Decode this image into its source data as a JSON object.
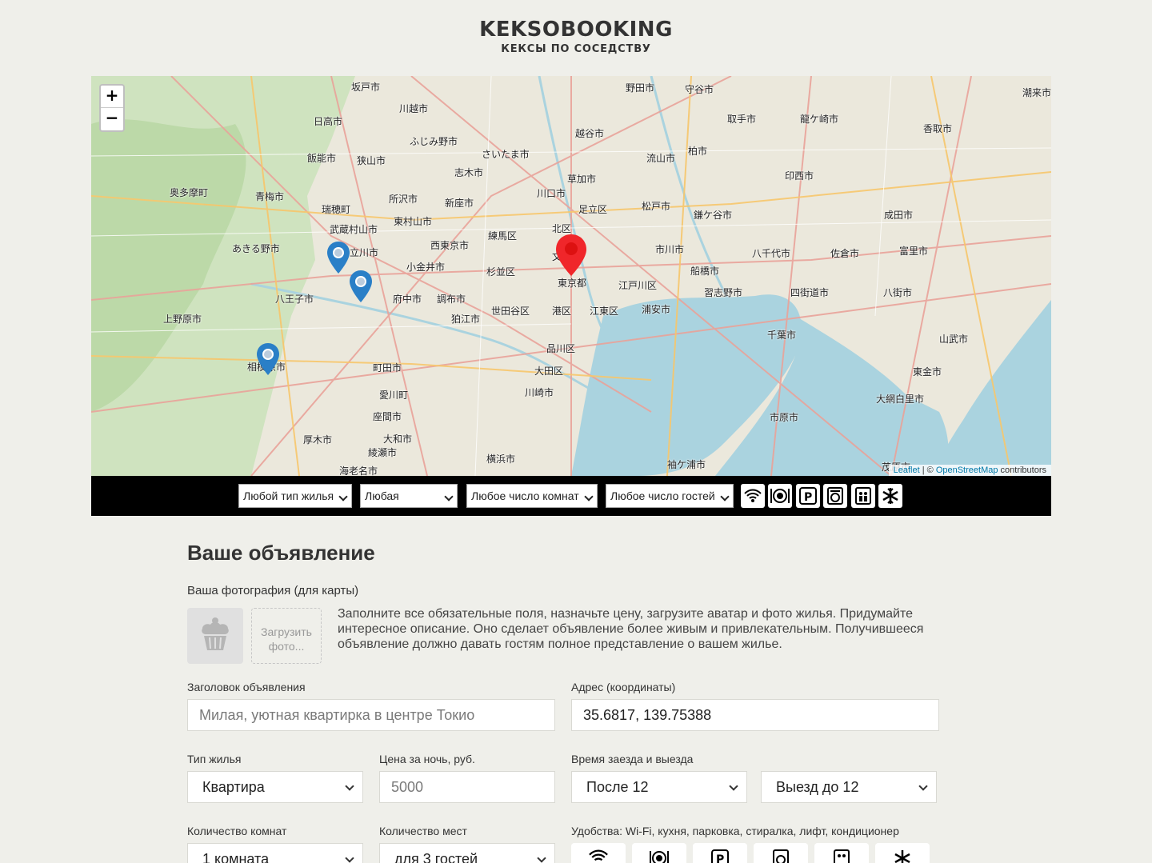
{
  "header": {
    "logo_title": "KEKSOBOOKING",
    "logo_subtitle": "КЕКСЫ ПО СОСЕДСТВУ"
  },
  "map": {
    "zoom_in": "+",
    "zoom_out": "−",
    "attribution_leaflet": "Leaflet",
    "attribution_sep": " | © ",
    "attribution_osm": "OpenStreetMap",
    "attribution_suffix": " contributors",
    "labels": [
      "坂戸市",
      "野田市",
      "守谷市",
      "潮来市",
      "日高市",
      "川越市",
      "越谷市",
      "取手市",
      "龍ケ崎市",
      "香取市",
      "ふじみ野市",
      "さいたま市",
      "柏市",
      "飯能市",
      "狭山市",
      "流山市",
      "志木市",
      "草加市",
      "印西市",
      "奥多摩町",
      "青梅市",
      "所沢市",
      "新座市",
      "川口市",
      "足立区",
      "松戸市",
      "鎌ケ谷市",
      "成田市",
      "東村山市",
      "北区",
      "瑞穂町",
      "武蔵村山市",
      "練馬区",
      "市川市",
      "八千代市",
      "佐倉市",
      "富里市",
      "あきる野市",
      "立川市",
      "西東京市",
      "文京区",
      "小金井市",
      "杉並区",
      "船橋市",
      "東京都",
      "江戸川区",
      "習志野市",
      "四街道市",
      "八街市",
      "八王子市",
      "府中市",
      "調布市",
      "世田谷区",
      "港区",
      "江東区",
      "浦安市",
      "上野原市",
      "狛江市",
      "千葉市",
      "山武市",
      "品川区",
      "相模原市",
      "町田市",
      "大田区",
      "東金市",
      "川崎市",
      "大網白里市",
      "愛川町",
      "座間市",
      "市原市",
      "大和市",
      "厚木市",
      "綾瀬市",
      "横浜市",
      "茂原市",
      "海老名市",
      "袖ケ浦市"
    ]
  },
  "filters": {
    "housing_type": "Любой тип жилья",
    "price": "Любая",
    "rooms": "Любое число комнат",
    "guests": "Любое число гостей",
    "features": [
      "wifi-icon",
      "dishwasher-icon",
      "parking-icon",
      "washer-icon",
      "elevator-icon",
      "conditioner-icon"
    ]
  },
  "form": {
    "title": "Ваше объявление",
    "avatar_label": "Ваша фотография (для карты)",
    "upload_label": "Загрузить фото...",
    "info": "Заполните все обязательные поля, назначьте цену, загрузите аватар и фото жилья. Придумайте интересное описание. Оно сделает объявление более живым и привлекательным. Получившееся объявление должно давать гостям полное представление о вашем жилье.",
    "title_label": "Заголовок объявления",
    "title_placeholder": "Милая, уютная квартирка в центре Токио",
    "address_label": "Адрес (координаты)",
    "address_value": "35.6817, 139.75388",
    "type_label": "Тип жилья",
    "type_value": "Квартира",
    "price_label": "Цена за ночь, руб.",
    "price_placeholder": "5000",
    "time_label": "Время заезда и выезда",
    "timein_value": "После 12",
    "timeout_value": "Выезд до 12",
    "rooms_label": "Количество комнат",
    "rooms_value": "1 комната",
    "capacity_label": "Количество мест",
    "capacity_value": "для 3 гостей",
    "features_label": "Удобства: Wi-Fi, кухня, парковка, стиралка, лифт, кондиционер"
  }
}
